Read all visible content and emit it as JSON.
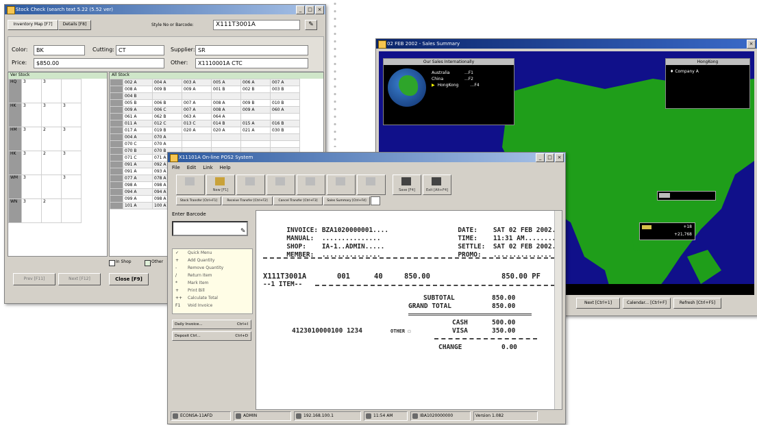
{
  "stock_window": {
    "title": "Stock Check (search text 5.22 (5.52 ver)",
    "tabs": [
      "Inventory Map [F7]",
      "Details [F8]"
    ],
    "scan_label": "Style No or Barcode:",
    "scan_value": "X111T3001A",
    "color_label": "Color:",
    "color_value": "BK",
    "cutting_label": "Cutting:",
    "cutting_value": "CT",
    "supplier_label": "Supplier:",
    "supplier_value": "SR",
    "price_label": "Price:",
    "price_value": "$850.00",
    "other_label": "Other:",
    "other_value": "X1110001A CTC",
    "left_grid_title": "Ver Stock",
    "left_rows": [
      [
        "HQ",
        "3",
        "3",
        ""
      ],
      [
        "HK",
        "3",
        "3",
        "3"
      ],
      [
        "HM",
        "3",
        "2",
        "3"
      ],
      [
        "HK",
        "3",
        "2",
        "3"
      ],
      [
        "WM",
        "3",
        "",
        "3"
      ],
      [
        "WN",
        "3",
        "2",
        ""
      ]
    ],
    "right_grid_title": "All Stock",
    "right_rows": [
      [
        "002 A",
        "004 A",
        "003 A",
        "005 A",
        "006 A",
        "007 A"
      ],
      [
        "008 A",
        "009 B",
        "009 A",
        "001 B",
        "002 B",
        "003 B"
      ],
      [
        "004 B",
        "",
        "",
        "",
        "",
        ""
      ],
      [
        "005 B",
        "006 B",
        "007 A",
        "008 A",
        "009 B",
        "010 B"
      ],
      [
        "009 A",
        "006 C",
        "007 A",
        "008 A",
        "009 A",
        "060 A"
      ],
      [
        "061 A",
        "062 B",
        "063 A",
        "064 A",
        "",
        ""
      ],
      [
        "011 A",
        "012 C",
        "013 C",
        "014 B",
        "015 A",
        "016 B"
      ],
      [
        "017 A",
        "019 B",
        "020 A",
        "020 A",
        "021 A",
        "030 B"
      ],
      [
        "004 A",
        "070 A",
        "",
        "",
        "",
        ""
      ],
      [
        "070 C",
        "070 A",
        "",
        "",
        "",
        ""
      ],
      [
        "070 B",
        "070 B",
        "",
        "",
        "",
        ""
      ],
      [
        "071 C",
        "071 A",
        "",
        "",
        "",
        ""
      ],
      [
        "091 A",
        "092 A",
        "",
        "",
        "",
        ""
      ],
      [
        "091 A",
        "093 A",
        "",
        "",
        "",
        ""
      ],
      [
        "077 A",
        "078 A",
        "",
        "",
        "",
        ""
      ],
      [
        "098 A",
        "098 A",
        "",
        "",
        "",
        ""
      ],
      [
        "094 A",
        "094 A",
        "",
        "",
        "",
        ""
      ],
      [
        "099 A",
        "098 A",
        "",
        "",
        "",
        ""
      ],
      [
        "101 A",
        "100 A",
        "",
        "",
        "",
        ""
      ]
    ],
    "chk_inshop": "In Shop",
    "chk_other": "Other",
    "bottom_buttons": [
      "Prev [F11]",
      "Next [F12]"
    ],
    "close_label": "Close [F9]"
  },
  "sales_window": {
    "title": "02 FEB 2002 - Sales Summary",
    "region_box_title": "Our Sales Internationally",
    "regions": [
      {
        "name": "Australia",
        "code": "...F1"
      },
      {
        "name": "China",
        "code": "...F2"
      },
      {
        "name": "HongKong",
        "code": "...F4"
      }
    ],
    "hk_box_title": "HongKong",
    "hk_company": "Company A",
    "popup_value_a": "+18",
    "popup_value_b": "+21,768",
    "buttons": [
      "Next [Ctrl+1]",
      "Calendar... [Ctrl+F]",
      "Refresh [Ctrl+F5]"
    ],
    "colors": {
      "sea": "#10108a",
      "land": "#1f9e1a"
    }
  },
  "pos_window": {
    "title": "X11101A On-line POS2 System",
    "menu": [
      "File",
      "Edit",
      "Link",
      "Help"
    ],
    "toolbar_big": [
      "",
      "New [F1]",
      "",
      "",
      "",
      "",
      "",
      "Save [F4]",
      "Exit [Alt+F4]"
    ],
    "toolbar_small": [
      "Stock Transfer [Ctrl+F1]",
      "Receive Transfer [Ctrl+F2]",
      "Cancel Transfer [Ctrl+F3]",
      "Sales Summary [Ctrl+F4]"
    ],
    "enter_barcode_label": "Enter Barcode",
    "side_items": [
      {
        "key": "✓",
        "label": "Quick Menu"
      },
      {
        "key": "+",
        "label": "Add Quantity"
      },
      {
        "key": "-",
        "label": "Remove Quantity"
      },
      {
        "key": "/",
        "label": "Return Item"
      },
      {
        "key": "*",
        "label": "Mark Item"
      },
      {
        "key": "+",
        "label": "Print Bill"
      },
      {
        "key": "++",
        "label": "Calculate Total"
      },
      {
        "key": "F1",
        "label": "Void Invoice"
      }
    ],
    "side_buttons": [
      {
        "label": "Daily Invoice...",
        "shortcut": "Ctrl+I"
      },
      {
        "label": "Deposit Ctrl...",
        "shortcut": "Ctrl+D"
      }
    ],
    "receipt": {
      "invoice_label": "INVOICE:",
      "invoice_value": "BZA1020000001....",
      "date_label": "DATE:",
      "date_value": "SAT 02 FEB 2002..",
      "manual_label": "MANUAL:",
      "manual_value": "...............",
      "time_label": "TIME:",
      "time_value": "11:31 AM.........",
      "shop_label": "SHOP:",
      "shop_value": "IA-1..ADMIN.....",
      "settle_label": "SETTLE:",
      "settle_value": "SAT 02 FEB 2002..",
      "member_label": "MEMBER:",
      "member_value": "...............",
      "promo_label": "PROMO:",
      "promo_value": "...............",
      "item_code": "X111T3001A",
      "item_qty": "001",
      "item_size": "40",
      "item_price": "850.00",
      "item_amount": "850.00 PF",
      "items_count": "--1 ITEM--",
      "subtotal_label": "SUBTOTAL",
      "subtotal_value": "850.00",
      "grand_label": "GRAND TOTAL",
      "grand_value": "850.00",
      "cash_label": "CASH",
      "cash_value": "500.00",
      "card_number": "4123010000100 1234",
      "card_other": "OTHER ☐",
      "visa_label": "VISA",
      "visa_value": "350.00",
      "change_label": "CHANGE",
      "change_value": "0.00"
    },
    "status": [
      "ECONSA-11AFD",
      "ADMIN",
      "192.168.100.1",
      "11:54 AM",
      "IBA1020000000",
      "Version 1.082"
    ]
  }
}
